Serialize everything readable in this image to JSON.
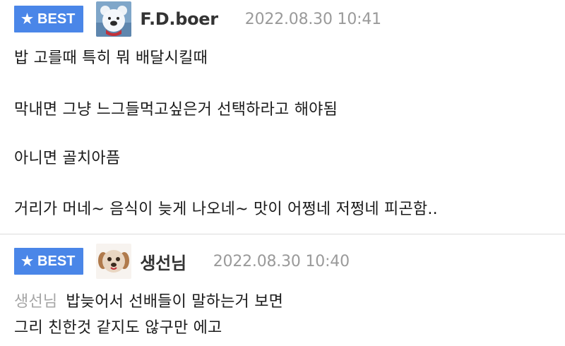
{
  "comments": [
    {
      "badge": "BEST",
      "author": "F.D.boer",
      "timestamp": "2022.08.30  10:41",
      "lines": [
        "밥 고를때 특히 뭐 배달시킬때",
        "막내면 그냥 느그들먹고싶은거 선택하라고 해야됨",
        "아니면 골치아픔",
        "거리가 머네~ 음식이 늦게 나오네~ 맛이 어쩡네 저쩡네 피곤함.."
      ]
    },
    {
      "badge": "BEST",
      "author": "생선님",
      "timestamp": "2022.08.30  10:40",
      "reply_to": "생선님",
      "lines": [
        "밥늦어서 선배들이 말하는거 보면",
        "그리 친한것 같지도 않구만 에고"
      ]
    }
  ],
  "colors": {
    "badge_bg": "#4a86e8",
    "timestamp": "#9a9a9a",
    "reply_to": "#a5a5a5",
    "divider": "#dcdcdc"
  },
  "icons": {
    "badge_icon": "star-icon",
    "avatar_1": "bear-avatar",
    "avatar_2": "puppy-avatar"
  }
}
